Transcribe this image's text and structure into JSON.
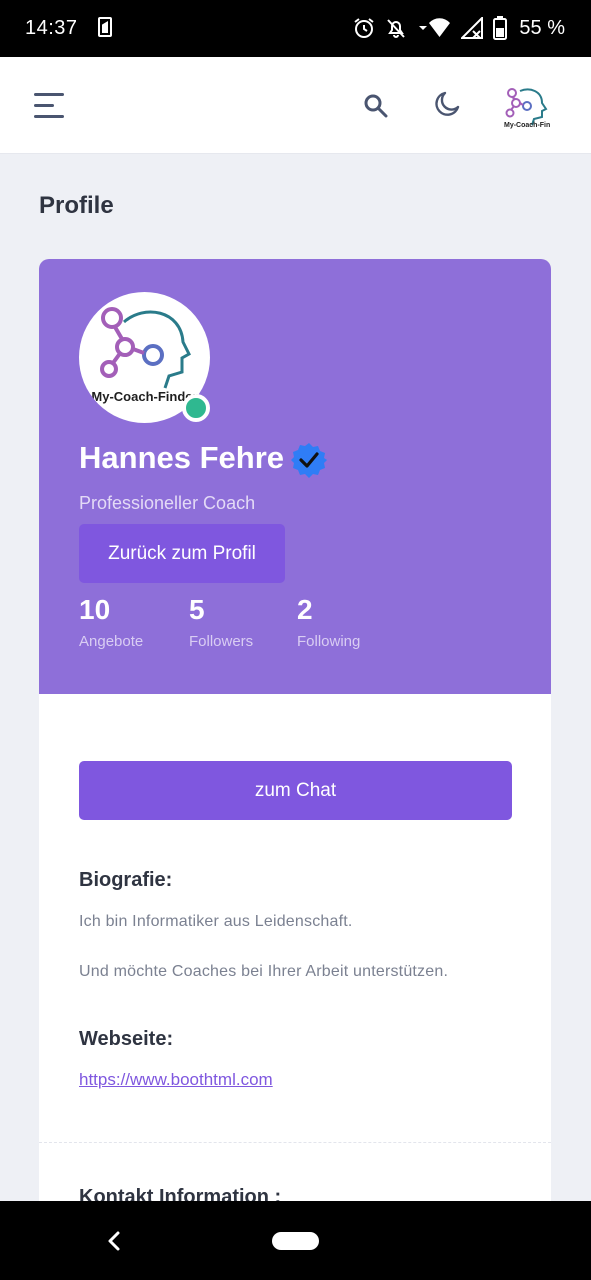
{
  "status_bar": {
    "time": "14:37",
    "battery": "55 %",
    "icons": [
      "sim-icon",
      "alarm-icon",
      "bell-off-icon",
      "wifi-icon",
      "signal-icon",
      "battery-icon"
    ]
  },
  "header": {
    "icons": [
      "menu-icon",
      "search-icon",
      "moon-icon",
      "logo"
    ]
  },
  "page": {
    "title": "Profile"
  },
  "profile": {
    "avatar_text": "My-Coach-Finder",
    "name": "Hannes Fehre",
    "role": "Professioneller Coach",
    "back_button": "Zurück zum Profil",
    "stats": [
      {
        "value": "10",
        "label": "Angebote"
      },
      {
        "value": "5",
        "label": "Followers"
      },
      {
        "value": "2",
        "label": "Following"
      }
    ]
  },
  "details": {
    "chat_button": "zum Chat",
    "bio_title": "Biografie:",
    "bio_lines": [
      "Ich bin Informatiker aus Leidenschaft.",
      "Und möchte Coaches bei Ihrer Arbeit unterstützen."
    ],
    "website_title": "Webseite:",
    "website_url": "https://www.boothtml.com",
    "contact_title": "Kontakt Information :"
  },
  "colors": {
    "accent": "#7f57df",
    "profile_bg": "#8e6fd9",
    "online": "#2fb890",
    "verified": "#2f7df6"
  }
}
